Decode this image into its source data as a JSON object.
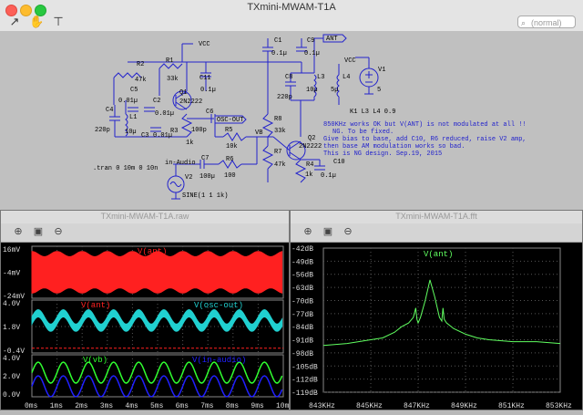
{
  "app": {
    "title": "TXmini-MWAM-T1A",
    "search_placeholder": "(normal)",
    "toolbar_icons": [
      "cursor-icon",
      "hand-icon",
      "probe-icon"
    ]
  },
  "schematic": {
    "labels": {
      "vcc_top": "VCC",
      "r2": "R2",
      "r2_val": "47k",
      "r1": "R1",
      "r1_val": "33k",
      "c11": "C11",
      "c11_val": "0.1µ",
      "q1": "Q1",
      "q1_val": "2N2222",
      "c5": "C5",
      "c5_val": "0.01µ",
      "c2": "C2",
      "c2_val": "0.01µ",
      "c4": "C4",
      "c4_val": "220p",
      "l1": "L1",
      "l1_val": "10µ",
      "c3": "C3",
      "c3_val": "0.01µ",
      "r3": "R3",
      "r3_val": "1k",
      "c6": "C6",
      "c6_val": "100p",
      "osc_out": "OSC-OUT",
      "r5": "R5",
      "r5_val": "10k",
      "vb": "VB",
      "c1": "C1",
      "c1_val": "0.1µ",
      "c9": "C9",
      "c9_val": "0.1µ",
      "ant": "ANT",
      "c8": "C8",
      "c8_val": "220p",
      "l3": "L3",
      "l3_val": "10µ",
      "l4": "L4",
      "l4_val": "5µ",
      "r8": "R8",
      "r8_val": "33k",
      "r7": "R7",
      "r7_val": "47k",
      "q2": "Q2",
      "q2_val": "2N2222",
      "r4": "R4",
      "r4_val": "1k",
      "c10": "C10",
      "c10_val": "0.1µ",
      "vcc_src": "VCC",
      "v1": "V1",
      "v1_val": "5",
      "k1": "K1 L3 L4 0.9",
      "tran": ".tran 0 10m 0 10n",
      "in_audio": "in-Audio",
      "v2": "V2",
      "v2_val": "SINE(1 1 1k)",
      "c7": "C7",
      "c7_val": "100µ",
      "r6": "R6",
      "r6_val": "100"
    },
    "notes": [
      "850KHz works OK but V(ANT) is not modulated at all !!",
      "NG. To be fixed.",
      "Give bias to base, add C10, R6 reduced, raise V2 amp,",
      "then base AM modulation works so bad.",
      "This is NG design. Sep.19, 2015"
    ]
  },
  "wave_window": {
    "title": "TXmini-MWAM-T1A.raw",
    "tool_icons": [
      "zoom-in-icon",
      "zoom-extent-icon",
      "zoom-out-icon"
    ],
    "panes": [
      {
        "traces": [
          {
            "name": "V(ant)",
            "color": "#ff2020"
          }
        ],
        "ticks": [
          "16mV",
          "-4mV",
          "-24mV"
        ]
      },
      {
        "traces": [
          {
            "name": "V(ant)",
            "color": "#ff2020"
          },
          {
            "name": "V(osc-out)",
            "color": "#20d0d0"
          }
        ],
        "ticks": [
          "4.0V",
          "1.8V",
          "-0.4V"
        ]
      },
      {
        "traces": [
          {
            "name": "V(vb)",
            "color": "#30ff30"
          },
          {
            "name": "V(in-audio)",
            "color": "#2020ff"
          }
        ],
        "ticks": [
          "4.0V",
          "2.0V",
          "0.0V"
        ]
      }
    ],
    "x_ticks": [
      "0ms",
      "1ms",
      "2ms",
      "3ms",
      "4ms",
      "5ms",
      "6ms",
      "7ms",
      "8ms",
      "9ms",
      "10ms"
    ]
  },
  "fft_window": {
    "title": "TXmini-MWAM-T1A.fft",
    "tool_icons": [
      "zoom-in-icon",
      "zoom-extent-icon",
      "zoom-out-icon"
    ],
    "trace": {
      "name": "V(ant)",
      "color": "#60ff60"
    },
    "y_ticks": [
      "-42dB",
      "-49dB",
      "-56dB",
      "-63dB",
      "-70dB",
      "-77dB",
      "-84dB",
      "-91dB",
      "-98dB",
      "-105dB",
      "-112dB",
      "-119dB"
    ],
    "x_ticks": [
      "843KHz",
      "845KHz",
      "847KHz",
      "849KHz",
      "851KHz",
      "853KHz"
    ]
  },
  "chart_data": [
    {
      "type": "line",
      "title": "TXmini-MWAM-T1A.raw",
      "xlabel": "",
      "x_ticks": [
        "0ms",
        "1ms",
        "2ms",
        "3ms",
        "4ms",
        "5ms",
        "6ms",
        "7ms",
        "8ms",
        "9ms",
        "10ms"
      ],
      "xlim_ms": [
        0,
        10
      ],
      "panes": [
        {
          "series": [
            {
              "name": "V(ant)",
              "color": "#ff2020",
              "carrier_amplitude_mV": [
                -20,
                12
              ],
              "envelope_period_ms": 1
            }
          ],
          "ylim_mV": [
            -24,
            16
          ]
        },
        {
          "series": [
            {
              "name": "V(ant)",
              "color": "#ff2020",
              "value_V": 0
            },
            {
              "name": "V(osc-out)",
              "color": "#20d0d0",
              "mean_V": 2.3,
              "envelope_V": [
                1.6,
                3.2
              ],
              "period_ms": 1
            }
          ],
          "ylim_V": [
            -0.4,
            4.0
          ]
        },
        {
          "series": [
            {
              "name": "V(vb)",
              "color": "#30ff30",
              "mean_V": 2.3,
              "amplitude_V": 1.0,
              "period_ms": 1
            },
            {
              "name": "V(in-audio)",
              "color": "#2020ff",
              "mean_V": 1.0,
              "amplitude_V": 1.0,
              "period_ms": 1
            }
          ],
          "ylim_V": [
            0.0,
            4.0
          ]
        }
      ],
      "grid": true
    },
    {
      "type": "line",
      "title": "TXmini-MWAM-T1A.fft",
      "series": [
        {
          "name": "V(ant)",
          "color": "#60ff60",
          "x_kHz": [
            843,
            844,
            845,
            845.5,
            846,
            846.3,
            846.6,
            846.8,
            846.9,
            846.95,
            847.0,
            847.1,
            847.3,
            847.5,
            847.7,
            847.9,
            848.0,
            848.05,
            848.1,
            848.2,
            848.5,
            849,
            849.5,
            850,
            851,
            852,
            853
          ],
          "y_dB": [
            -94,
            -93,
            -91,
            -90,
            -87,
            -84,
            -82,
            -79,
            -74,
            -80,
            -82,
            -79,
            -70,
            -59,
            -68,
            -79,
            -81,
            -74,
            -80,
            -82,
            -85,
            -88,
            -90,
            -91,
            -92,
            -92,
            -93
          ]
        }
      ],
      "x_ticks": [
        "843KHz",
        "845KHz",
        "847KHz",
        "849KHz",
        "851KHz",
        "853KHz"
      ],
      "xlim_kHz": [
        843,
        853
      ],
      "ylim_dB": [
        -119,
        -42
      ],
      "grid": true
    }
  ]
}
